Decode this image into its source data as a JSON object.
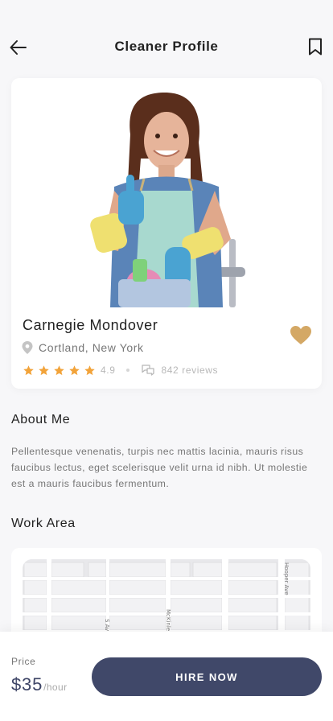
{
  "header": {
    "title": "Cleaner Profile"
  },
  "profile": {
    "name": "Carnegie Mondover",
    "location": "Cortland, New York",
    "rating": "4.9",
    "stars": 5,
    "reviews": "842 reviews"
  },
  "about": {
    "title": "About Me",
    "text": "Pellentesque venenatis, turpis nec mattis lacinia, mauris risus faucibus lectus, eget scelerisque velit urna id nibh. Ut molestie est a mauris faucibus fermentum."
  },
  "work_area": {
    "title": "Work Area",
    "streets": [
      "Hooper Ave",
      "McKinle",
      "S Av"
    ]
  },
  "footer": {
    "price_label": "Price",
    "price": "$35",
    "price_unit": "/hour",
    "hire_label": "HIRE NOW"
  },
  "colors": {
    "accent": "#404869",
    "star": "#f2a33a",
    "heart": "#d4a865"
  },
  "icons": {
    "back": "arrow-left-icon",
    "bookmark": "bookmark-icon",
    "location": "pin-icon",
    "favorite": "heart-icon",
    "reviews": "chat-bubbles-icon"
  }
}
